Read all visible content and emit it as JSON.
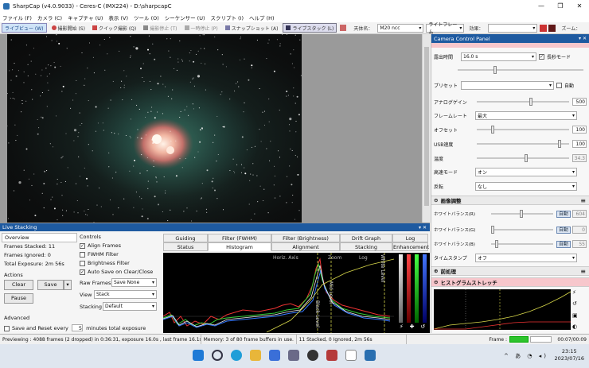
{
  "window": {
    "title": "SharpCap (v4.0.9033) - Ceres-C (IMX224) - D:\\sharpcapC"
  },
  "menu": [
    "ファイル (F)",
    "カメラ (C)",
    "キャプチャ (U)",
    "表示 (V)",
    "ツール (O)",
    "シーケンサー (U)",
    "スクリプト (I)",
    "ヘルプ (H)"
  ],
  "toolbar": {
    "items": [
      "ライブビュー (W)",
      "撮影開始 (S)",
      "クイック撮影 (Q)",
      "撮影停止 (T)",
      "一時停止 (P)",
      "スナップショット (A)",
      "ライブスタック (L)"
    ],
    "target_label": "天体名：",
    "target_value": "M20 ncc",
    "frame_mode": "ライトフレーム",
    "effect_label": "効果：",
    "zoom_label": "ズーム："
  },
  "camera_panel": {
    "title": "Camera Control Panel",
    "exposure_label": "露出時間",
    "exposure_value": "16.0 s",
    "long_mode_label": "長秒モード",
    "preset_label": "プリセット",
    "auto_label": "自動",
    "controls": [
      {
        "label": "アナログゲイン",
        "value": "500"
      },
      {
        "label": "フレームレート",
        "value": "最大"
      },
      {
        "label": "オフセット",
        "value": "100"
      },
      {
        "label": "USB速度",
        "value": "100"
      },
      {
        "label": "温度",
        "value": "34.3"
      },
      {
        "label": "高速モード",
        "value": "オン"
      },
      {
        "label": "反転",
        "value": "なし"
      }
    ],
    "image_adjust_title": "画像調整",
    "wb": [
      {
        "label": "ホワイトバランス(R)",
        "auto": "自動",
        "value": "604"
      },
      {
        "label": "ホワイトバランス(G)",
        "auto": "自動",
        "value": "0"
      },
      {
        "label": "ホワイトバランス(B)",
        "auto": "自動",
        "value": "55"
      }
    ],
    "timestamp_label": "タイムスタンプ",
    "timestamp_value": "オフ",
    "preprocess_title": "前処理",
    "histstretch_title": "ヒストグラムストレッチ"
  },
  "live_stacking": {
    "title": "Live Stacking",
    "overview_label": "Overview",
    "frames_stacked": "Frames Stacked: 11",
    "frames_ignored": "Frames Ignored: 0",
    "total_exposure": "Total Exposure:  2m 56s",
    "actions_label": "Actions",
    "clear_btn": "Clear",
    "save_btn": "Save",
    "pause_btn": "Pause",
    "advanced_label": "Advanced",
    "save_reset_label": "Save and Reset every",
    "save_reset_value": "5",
    "save_reset_unit": "minutes total exposure",
    "controls_label": "Controls",
    "align_frames": "Align Frames",
    "fwhm_filter": "FWHM Filter",
    "brightness_filter": "Brightness Filter",
    "auto_save": "Auto Save on Clear/Close",
    "raw_frames_label": "Raw Frames",
    "raw_frames_value": "Save None",
    "view_label": "View",
    "view_value": "Stack",
    "stacking_label": "Stacking",
    "stacking_value": "Default",
    "tabs_top": [
      "Guiding",
      "Filter (FWHM)",
      "Filter (Brightness)",
      "Drift Graph",
      "Log"
    ],
    "tabs_bottom": [
      "Status",
      "Histogram",
      "Alignment",
      "Stacking",
      "Enhancement"
    ],
    "histo_labels": [
      "Horiz. Axis",
      "Zoom",
      "Log",
      "White Level",
      "Black Level",
      "Mid Level"
    ]
  },
  "status": {
    "preview": "Previewing : 4088 frames (2 dropped) in 0:36:31, exposure 16.0s , last frame 16.1s",
    "memory": "Memory: 3 of 80 frame buffers in use.",
    "stacked": "11 Stacked, 0 Ignored, 2m 56s",
    "frame_label": "Frame :",
    "frame_time": "00:07/00:09"
  },
  "taskbar": {
    "time": "23:15",
    "date": "2023/07/16"
  }
}
